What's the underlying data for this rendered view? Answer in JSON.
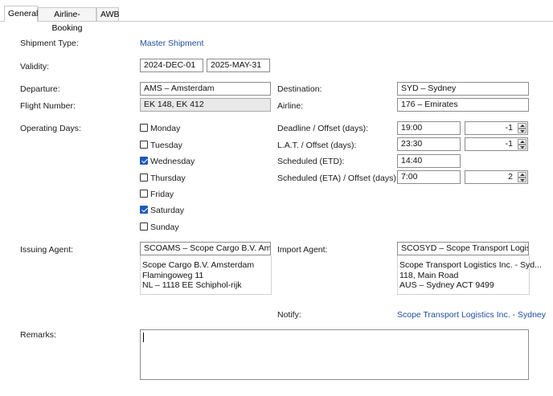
{
  "tabs": [
    {
      "label": "General",
      "active": true
    },
    {
      "label": "Airline-Booking",
      "active": false
    },
    {
      "label": "AWB",
      "active": false
    }
  ],
  "shipment_type": {
    "label": "Shipment Type:",
    "value": "Master Shipment"
  },
  "validity": {
    "label": "Validity:",
    "from": "2024-DEC-01",
    "to": "2025-MAY-31"
  },
  "departure": {
    "label": "Departure:",
    "value": "AMS – Amsterdam"
  },
  "destination": {
    "label": "Destination:",
    "value": "SYD – Sydney"
  },
  "flight_number": {
    "label": "Flight Number:",
    "value": "EK 148, EK 412"
  },
  "airline": {
    "label": "Airline:",
    "value": "176 – Emirates"
  },
  "operating_days": {
    "label": "Operating Days:",
    "days": [
      {
        "label": "Monday",
        "checked": false
      },
      {
        "label": "Tuesday",
        "checked": false
      },
      {
        "label": "Wednesday",
        "checked": true
      },
      {
        "label": "Thursday",
        "checked": false
      },
      {
        "label": "Friday",
        "checked": false
      },
      {
        "label": "Saturday",
        "checked": true
      },
      {
        "label": "Sunday",
        "checked": false
      }
    ]
  },
  "deadline": {
    "label": "Deadline / Offset (days):",
    "time": "19:00",
    "offset": "-1"
  },
  "lat": {
    "label": "L.A.T. / Offset (days):",
    "time": "23:30",
    "offset": "-1"
  },
  "etd": {
    "label": "Scheduled (ETD):",
    "time": "14:40"
  },
  "eta": {
    "label": "Scheduled (ETA) / Offset (days):",
    "time": "7:00",
    "offset": "2"
  },
  "issuing_agent": {
    "label": "Issuing Agent:",
    "value": "SCOAMS – Scope Cargo B.V. Amsterdam",
    "address": [
      "Scope Cargo B.V. Amsterdam",
      "Flamingoweg 11",
      "NL – 1118 EE Schiphol-rijk"
    ]
  },
  "import_agent": {
    "label": "Import Agent:",
    "value": "SCOSYD – Scope Transport Logistics Inc.",
    "address": [
      "Scope Transport Logistics Inc.  - Syd...",
      "118, Main Road",
      "AUS – Sydney ACT 9499"
    ]
  },
  "notify": {
    "label": "Notify:",
    "value": "Scope Transport Logistics Inc.  - Sydney"
  },
  "remarks": {
    "label": "Remarks:",
    "value": ""
  }
}
